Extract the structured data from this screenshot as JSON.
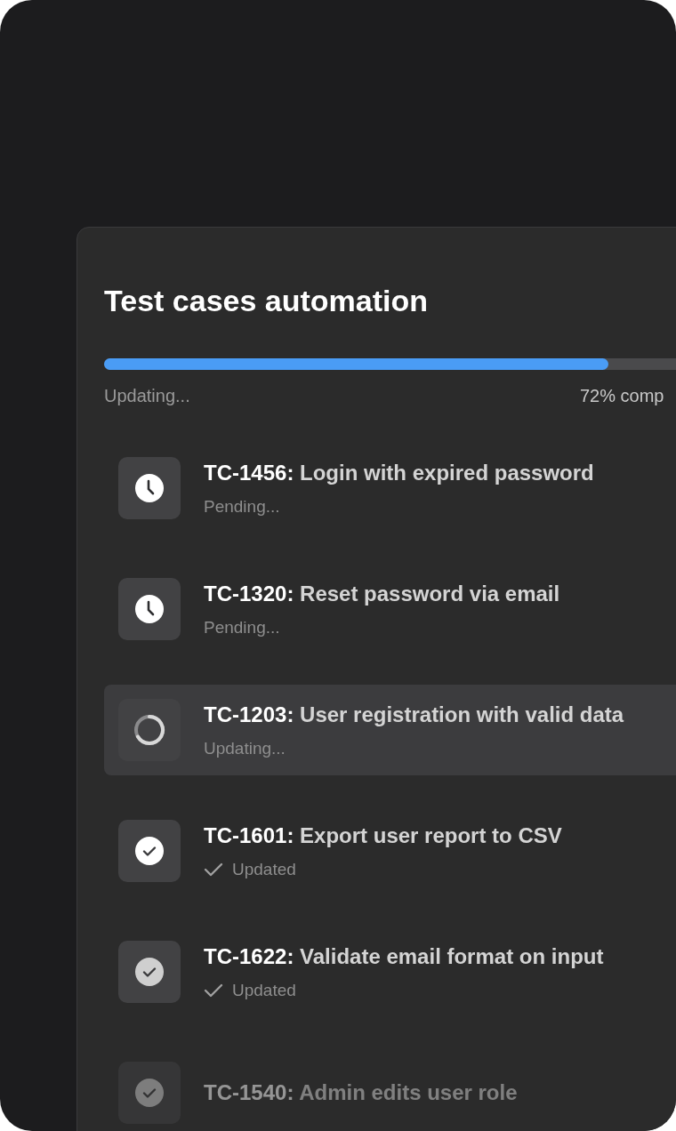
{
  "panel": {
    "title": "Test cases automation",
    "progress": {
      "level": 0.72,
      "status": "Updating...",
      "reading": "72% comp"
    },
    "cases": [
      {
        "code": "TC-1456:",
        "name": "Login with expired password",
        "kind": "pending",
        "status": "Pending...",
        "selected": false,
        "faded": false
      },
      {
        "code": "TC-1320:",
        "name": "Reset password via email",
        "kind": "pending",
        "status": "Pending...",
        "selected": false,
        "faded": false
      },
      {
        "code": "TC-1203:",
        "name": "User registration with valid data",
        "kind": "running",
        "status": "Updating...",
        "selected": true,
        "faded": false
      },
      {
        "code": "TC-1601:",
        "name": "Export user report to CSV",
        "kind": "done",
        "status": "Updated",
        "selected": false,
        "faded": false
      },
      {
        "code": "TC-1622:",
        "name": "Validate email format on input",
        "kind": "done",
        "status": "Updated",
        "selected": false,
        "faded": false
      },
      {
        "code": "TC-1540:",
        "name": "Admin edits user role",
        "kind": "done",
        "selected": false,
        "faded": true
      }
    ]
  }
}
